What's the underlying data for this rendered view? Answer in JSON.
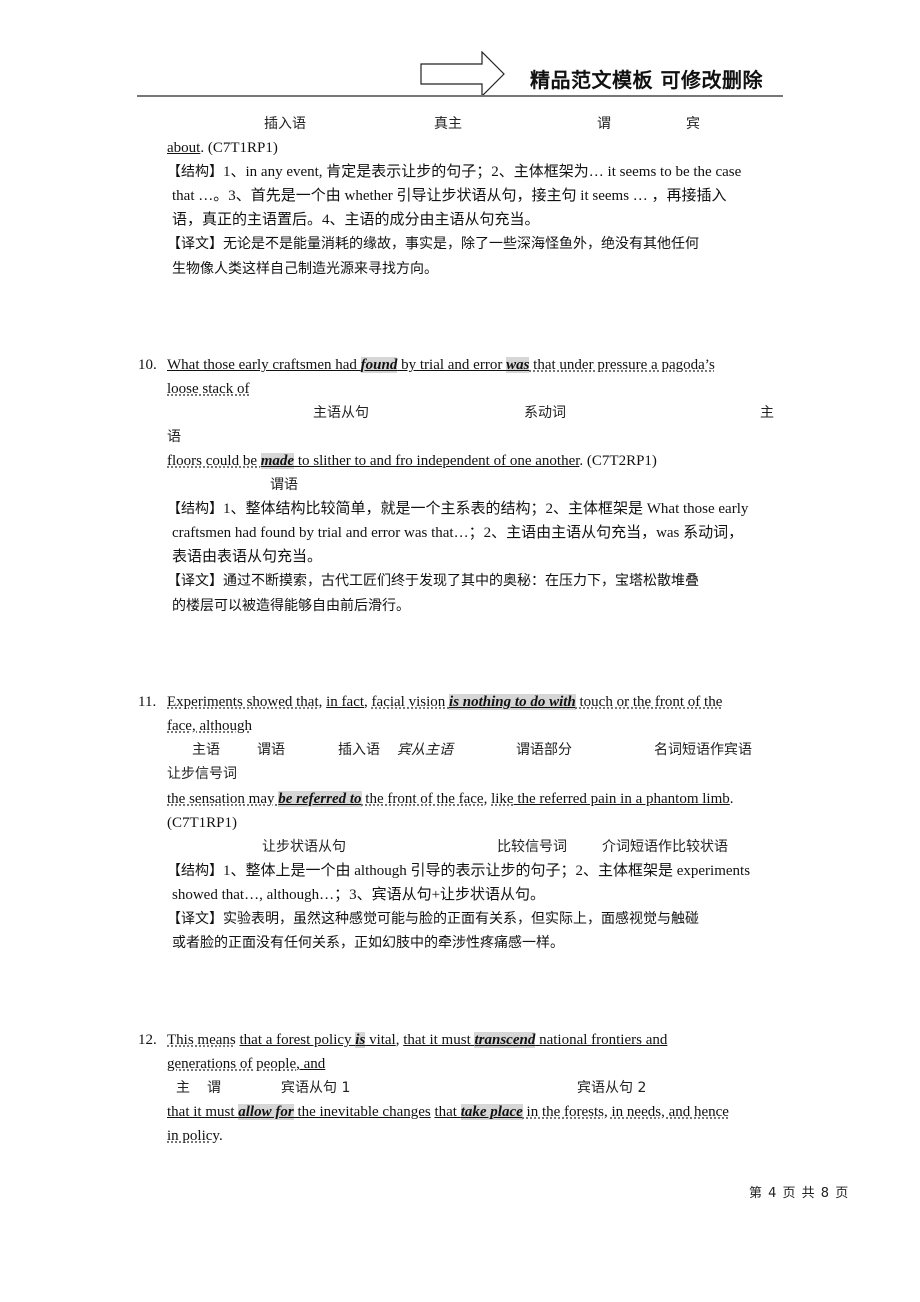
{
  "header": {
    "title": "精品范文模板 可修改删除"
  },
  "section9_tail": {
    "annotations": [
      "插入语",
      "真主",
      "谓",
      "宾"
    ],
    "sentence_end": "about",
    "source": ". (C7T1RP1)",
    "structure_label": "【结构】",
    "structure_lines": [
      "1、in any event, 肯定是表示让步的句子；2、主体框架为… it seems to be the case",
      "that …。3、首先是一个由 whether 引导让步状语从句，接主句 it seems … ，再接插入",
      "语，真正的主语置后。4、主语的成分由主语从句充当。"
    ],
    "translation_label": "【译文】",
    "translation_lines": [
      "无论是不是能量消耗的缘故，事实是，除了一些深海怪鱼外，绝没有其他任何",
      "生物像人类这样自己制造光源来寻找方向。"
    ]
  },
  "items": [
    {
      "number": "10.",
      "line1": [
        "What those early craftsmen had ",
        "found",
        " by trial and error ",
        "was",
        " that under pressure a pagoda’s "
      ],
      "line2": "loose stack of ",
      "annotations1": [
        "主语从句",
        "系动词",
        "主"
      ],
      "annotations1_wrap": "语",
      "line3": [
        "floors could be ",
        "made",
        " to slither to and fro independent of one another",
        ". (C7T2RP1)"
      ],
      "annotations2": [
        "谓语"
      ],
      "structure_label": "【结构】",
      "structure_lines": [
        "1、整体结构比较简单，就是一个主系表的结构；2、主体框架是 What those early",
        "craftsmen had found by trial and error was that…；2、主语由主语从句充当，was 系动词，",
        "表语由表语从句充当。"
      ],
      "translation_label": "【译文】",
      "translation_lines": [
        "通过不断摸索，古代工匠们终于发现了其中的奥秘：在压力下，宝塔松散堆叠",
        "的楼层可以被造得能够自由前后滑行。"
      ]
    },
    {
      "number": "11.",
      "line1": [
        "Experiments showed that",
        ", ",
        "in fact",
        ", ",
        "facial vision ",
        "is nothing to do with",
        " touch or the front of the "
      ],
      "line2": [
        "face, although "
      ],
      "annotations1": [
        "主语",
        "谓语",
        "插入语",
        "宾从主语",
        "谓语部分",
        "名词短语作宾语"
      ],
      "annotations1_wrap": "让步信号词",
      "line3": [
        "the sensation may ",
        "be referred to",
        " the front of the face",
        ", ",
        "like",
        " the referred pain in a phantom limb",
        "."
      ],
      "line3_source": "(C7T1RP1)",
      "annotations2": [
        "让步状语从句",
        "比较信号词",
        "介词短语作比较状语"
      ],
      "structure_label": "【结构】",
      "structure_lines": [
        "1、整体上是一个由 although 引导的表示让步的句子；2、主体框架是 experiments",
        "showed that…, although…；3、宾语从句+让步状语从句。"
      ],
      "translation_label": "【译文】",
      "translation_lines": [
        "实验表明，虽然这种感觉可能与脸的正面有关系，但实际上，面感视觉与触碰",
        "或者脸的正面没有任何关系，正如幻肢中的牵涉性疼痛感一样。"
      ]
    },
    {
      "number": "12.",
      "line1": [
        "This means",
        " ",
        "that a forest policy ",
        "is",
        " vital",
        ", ",
        "that it must ",
        "transcend",
        " national frontiers and "
      ],
      "line2": [
        "generations of people",
        ", and"
      ],
      "annotations1": [
        "主",
        "谓",
        "宾语从句 1",
        "宾语从句 2"
      ],
      "line3": [
        "that it must ",
        "allow for",
        " the inevitable changes",
        " ",
        "that ",
        "take place",
        " in the forests, in needs, and hence "
      ],
      "line4": [
        "in policy",
        "."
      ]
    }
  ],
  "footer": {
    "page_label": "第 4 页 共 8 页"
  }
}
